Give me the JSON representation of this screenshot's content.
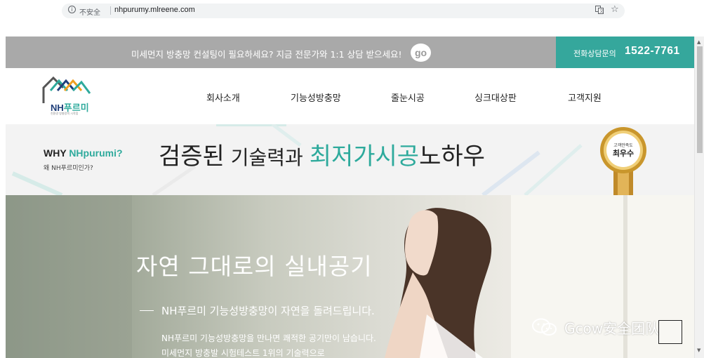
{
  "browser": {
    "info_glyph": "i",
    "security_label": "不安全",
    "url": "nhpurumy.mlreene.com",
    "translate_icon": "translate-icon",
    "bookmark_icon": "star-icon"
  },
  "topbar": {
    "message": "미세먼지 방충망 컨설팅이 필요하세요? 지금 전문가와 1:1 상담 받으세요!",
    "go_label": "go",
    "phone_label": "전화상담문의",
    "phone_number": "1522-7761",
    "accent_color": "#35a79c"
  },
  "logo": {
    "part1": "NH",
    "part2": "푸르미",
    "tagline": "친환경 방충망의 시작점"
  },
  "nav": {
    "items": [
      "회사소개",
      "기능성방충망",
      "줄눈시공",
      "싱크대상판",
      "고객지원"
    ]
  },
  "why": {
    "title_prefix": "WHY ",
    "title_accent": "NHpurumi?",
    "subtitle": "왜 NH푸르미인가?",
    "slogan_a": "검증된",
    "slogan_b": " 기술력과 ",
    "slogan_c": "최저가시공",
    "slogan_d": "노하우",
    "medal_line1": "고객만족도",
    "medal_line2": "최우수"
  },
  "hero": {
    "title": "자연 그대로의 실내공기",
    "subtitle": "NH푸르미 기능성방충망이 자연을 돌려드립니다.",
    "paragraph1": "NH푸르미 기능성방충망을 만나면 쾌적한 공기만이 남습니다.",
    "paragraph2": "미세먼지 방충발 시험테스트 1위의 기술력으로"
  },
  "watermark": {
    "text": "Gcow安全团队",
    "icon": "wechat-icon"
  },
  "colors": {
    "teal": "#2eaa9c",
    "navy": "#1f3f7a",
    "topbar_gray": "#a9a9a9"
  }
}
